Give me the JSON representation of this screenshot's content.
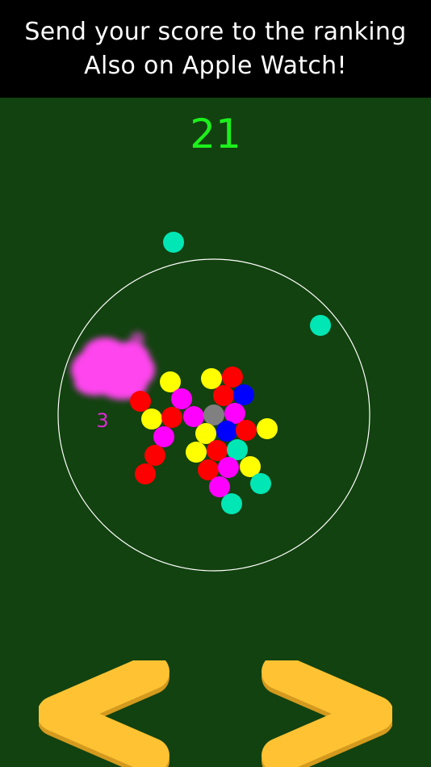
{
  "banner": {
    "line1": "Send your score to the ranking",
    "line2": "Also on Apple Watch!"
  },
  "game": {
    "score": "21",
    "combo_label": "3",
    "colors": {
      "background": "#12420f",
      "score": "#1cf01c",
      "ring": "#ffffff",
      "red": "#ff0000",
      "yellow": "#ffff00",
      "magenta": "#ff00ff",
      "blue": "#0000ff",
      "teal": "#00e6b4",
      "gray": "#808080",
      "splash": "#ff44ee",
      "arrow": "#ffc233",
      "arrow_edge": "#d49a1e"
    },
    "controls": {
      "left": "left-arrow-button",
      "right": "right-arrow-button"
    }
  }
}
